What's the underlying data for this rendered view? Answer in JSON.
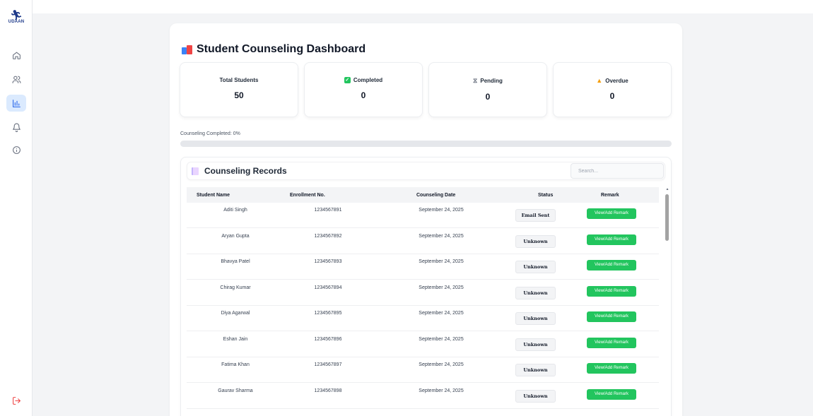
{
  "sidebar": {
    "logo_text": "UDAAN",
    "items": [
      {
        "name": "home",
        "icon": "home-icon"
      },
      {
        "name": "students",
        "icon": "users-icon"
      },
      {
        "name": "analytics",
        "icon": "bar-chart-icon",
        "active": true
      },
      {
        "name": "notifications",
        "icon": "bell-icon"
      },
      {
        "name": "info",
        "icon": "info-icon"
      }
    ],
    "logout_icon": "logout-icon"
  },
  "colors": {
    "accent": "#22c55e",
    "active_nav": "#dbeafe",
    "logout": "#ef4444"
  },
  "page": {
    "title": "Student Counseling Dashboard"
  },
  "stats": {
    "total": {
      "label": "Total Students",
      "value": "50"
    },
    "completed": {
      "label": "Completed",
      "value": "0"
    },
    "pending": {
      "label": "Pending",
      "value": "0"
    },
    "overdue": {
      "label": "Overdue",
      "value": "0"
    }
  },
  "progress": {
    "label": "Counseling Completed: 0%",
    "percent": 0
  },
  "records": {
    "title": "Counseling Records",
    "search_placeholder": "Search...",
    "columns": [
      "Student Name",
      "Enrollment No.",
      "Counseling Date",
      "Status",
      "Remark"
    ],
    "rows": [
      {
        "name": "Aditi Singh",
        "enrollment": "1234567891",
        "date": "September 24, 2025",
        "status": "Email Sent",
        "remark": "View/Add Remark"
      },
      {
        "name": "Aryan Gupta",
        "enrollment": "1234567892",
        "date": "September 24, 2025",
        "status": "Unknown",
        "remark": "View/Add Remark"
      },
      {
        "name": "Bhavya Patel",
        "enrollment": "1234567893",
        "date": "September 24, 2025",
        "status": "Unknown",
        "remark": "View/Add Remark"
      },
      {
        "name": "Chirag Kumar",
        "enrollment": "1234567894",
        "date": "September 24, 2025",
        "status": "Unknown",
        "remark": "View/Add Remark"
      },
      {
        "name": "Diya Agarwal",
        "enrollment": "1234567895",
        "date": "September 24, 2025",
        "status": "Unknown",
        "remark": "View/Add Remark"
      },
      {
        "name": "Eshan Jain",
        "enrollment": "1234567896",
        "date": "September 24, 2025",
        "status": "Unknown",
        "remark": "View/Add Remark"
      },
      {
        "name": "Fatima Khan",
        "enrollment": "1234567897",
        "date": "September 24, 2025",
        "status": "Unknown",
        "remark": "View/Add Remark"
      },
      {
        "name": "Gaurav Sharma",
        "enrollment": "1234567898",
        "date": "September 24, 2025",
        "status": "Unknown",
        "remark": "View/Add Remark"
      }
    ]
  }
}
